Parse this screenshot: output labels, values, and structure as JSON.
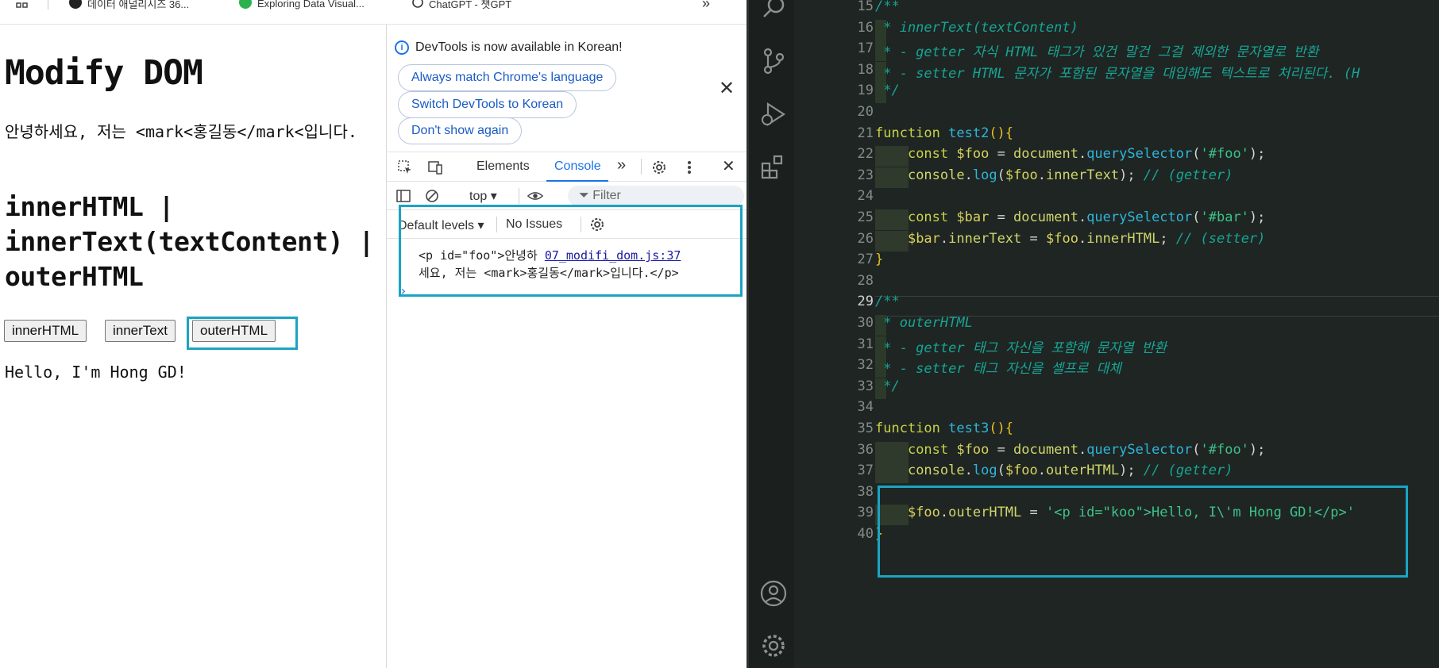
{
  "bookmarks": [
    {
      "icon": "apps-grid-icon",
      "label": ""
    },
    {
      "icon": "github-icon",
      "label": "데이터 애널리시즈 36..."
    },
    {
      "icon": "green-shield-icon",
      "label": "Exploring Data Visual..."
    },
    {
      "icon": "openai-icon",
      "label": "ChatGPT - 챗GPT"
    },
    {
      "icon": "more-bookmarks-icon",
      "label": "»"
    }
  ],
  "page": {
    "title": "Modify DOM",
    "intro": "안녕하세요, 저는 <mark<홍길동</mark<입니다.",
    "heading": "innerHTML | innerText(textContent) | outerHTML",
    "buttons": [
      "innerHTML",
      "innerText",
      "outerHTML"
    ],
    "result": "Hello, I'm Hong GD!"
  },
  "devtools": {
    "notice": "DevTools is now available in Korean!",
    "notice_buttons": [
      "Always match Chrome's language",
      "Switch DevTools to Korean",
      "Don't show again"
    ],
    "tabs": [
      "Elements",
      "Console"
    ],
    "active_tab": "Console",
    "context": "top",
    "filter_placeholder": "Filter",
    "levels": "Default levels",
    "issues": "No Issues",
    "console_log": {
      "text_line1": "<p id=\"foo\">안녕하",
      "source": "07_modifi_dom.js:37",
      "text_line2": "세요, 저는 <mark>홍길동</mark>입니다.</p>"
    },
    "prompt": "›",
    "accent_color": "#1a73e8"
  },
  "editor": {
    "current_line": 29,
    "lines": [
      {
        "n": 15,
        "tokens": [
          [
            "c-com",
            "/**"
          ]
        ]
      },
      {
        "n": 16,
        "tokens": [
          [
            "c-com",
            " * innerText(textContent)"
          ]
        ]
      },
      {
        "n": 17,
        "tokens": [
          [
            "c-com",
            " * - getter 자식 HTML 태그가 있건 말건 그걸 제외한 문자열로 반환"
          ]
        ]
      },
      {
        "n": 18,
        "tokens": [
          [
            "c-com",
            " * - setter HTML 문자가 포함된 문자열을 대입해도 텍스트로 처리된다. (H"
          ]
        ]
      },
      {
        "n": 19,
        "tokens": [
          [
            "c-com",
            " */"
          ]
        ]
      },
      {
        "n": 20,
        "tokens": []
      },
      {
        "n": 21,
        "tokens": [
          [
            "c-kw",
            "function "
          ],
          [
            "c-fn",
            "test2"
          ],
          [
            "c-br",
            "(){"
          ]
        ]
      },
      {
        "n": 22,
        "tokens": [
          [
            "c-plain",
            "    "
          ],
          [
            "c-kw",
            "const "
          ],
          [
            "c-var",
            "$foo"
          ],
          [
            "c-plain",
            " = "
          ],
          [
            "c-prop",
            "document"
          ],
          [
            "c-plain",
            "."
          ],
          [
            "c-fn",
            "querySelector"
          ],
          [
            "c-plain",
            "("
          ],
          [
            "c-str",
            "'#foo'"
          ],
          [
            "c-plain",
            ");"
          ]
        ]
      },
      {
        "n": 23,
        "tokens": [
          [
            "c-plain",
            "    "
          ],
          [
            "c-prop",
            "console"
          ],
          [
            "c-plain",
            "."
          ],
          [
            "c-fn",
            "log"
          ],
          [
            "c-plain",
            "("
          ],
          [
            "c-var",
            "$foo"
          ],
          [
            "c-plain",
            "."
          ],
          [
            "c-prop",
            "innerText"
          ],
          [
            "c-plain",
            "); "
          ],
          [
            "c-com",
            "// (getter)"
          ]
        ]
      },
      {
        "n": 24,
        "tokens": []
      },
      {
        "n": 25,
        "tokens": [
          [
            "c-plain",
            "    "
          ],
          [
            "c-kw",
            "const "
          ],
          [
            "c-var",
            "$bar"
          ],
          [
            "c-plain",
            " = "
          ],
          [
            "c-prop",
            "document"
          ],
          [
            "c-plain",
            "."
          ],
          [
            "c-fn",
            "querySelector"
          ],
          [
            "c-plain",
            "("
          ],
          [
            "c-str",
            "'#bar'"
          ],
          [
            "c-plain",
            ");"
          ]
        ]
      },
      {
        "n": 26,
        "tokens": [
          [
            "c-plain",
            "    "
          ],
          [
            "c-var",
            "$bar"
          ],
          [
            "c-plain",
            "."
          ],
          [
            "c-prop",
            "innerText"
          ],
          [
            "c-plain",
            " = "
          ],
          [
            "c-var",
            "$foo"
          ],
          [
            "c-plain",
            "."
          ],
          [
            "c-prop",
            "innerHTML"
          ],
          [
            "c-plain",
            "; "
          ],
          [
            "c-com",
            "// (setter)"
          ]
        ]
      },
      {
        "n": 27,
        "tokens": [
          [
            "c-br",
            "}"
          ]
        ]
      },
      {
        "n": 28,
        "tokens": []
      },
      {
        "n": 29,
        "tokens": [
          [
            "c-com",
            "/**"
          ]
        ]
      },
      {
        "n": 30,
        "tokens": [
          [
            "c-com",
            " * outerHTML"
          ]
        ]
      },
      {
        "n": 31,
        "tokens": [
          [
            "c-com",
            " * - getter 태그 자신을 포함해 문자열 반환"
          ]
        ]
      },
      {
        "n": 32,
        "tokens": [
          [
            "c-com",
            " * - setter 태그 자신을 셀프로 대체"
          ]
        ]
      },
      {
        "n": 33,
        "tokens": [
          [
            "c-com",
            " */"
          ]
        ]
      },
      {
        "n": 34,
        "tokens": []
      },
      {
        "n": 35,
        "tokens": [
          [
            "c-kw",
            "function "
          ],
          [
            "c-fn",
            "test3"
          ],
          [
            "c-br",
            "(){"
          ]
        ]
      },
      {
        "n": 36,
        "tokens": [
          [
            "c-plain",
            "    "
          ],
          [
            "c-kw",
            "const "
          ],
          [
            "c-var",
            "$foo"
          ],
          [
            "c-plain",
            " = "
          ],
          [
            "c-prop",
            "document"
          ],
          [
            "c-plain",
            "."
          ],
          [
            "c-fn",
            "querySelector"
          ],
          [
            "c-plain",
            "("
          ],
          [
            "c-str",
            "'#foo'"
          ],
          [
            "c-plain",
            ");"
          ]
        ]
      },
      {
        "n": 37,
        "tokens": [
          [
            "c-plain",
            "    "
          ],
          [
            "c-prop",
            "console"
          ],
          [
            "c-plain",
            "."
          ],
          [
            "c-fn",
            "log"
          ],
          [
            "c-plain",
            "("
          ],
          [
            "c-var",
            "$foo"
          ],
          [
            "c-plain",
            "."
          ],
          [
            "c-prop",
            "outerHTML"
          ],
          [
            "c-plain",
            "); "
          ],
          [
            "c-com",
            "// (getter)"
          ]
        ]
      },
      {
        "n": 38,
        "tokens": []
      },
      {
        "n": 39,
        "tokens": [
          [
            "c-plain",
            "    "
          ],
          [
            "c-var",
            "$foo"
          ],
          [
            "c-plain",
            "."
          ],
          [
            "c-prop",
            "outerHTML"
          ],
          [
            "c-plain",
            " = "
          ],
          [
            "c-str",
            "'<p id=\"koo\">Hello, I\\'m Hong GD!</p>'"
          ]
        ]
      },
      {
        "n": 40,
        "tokens": [
          [
            "c-br",
            "}"
          ]
        ]
      }
    ],
    "highlight_color": "#1aa4c4"
  },
  "activity_bar": [
    "search-icon",
    "source-control-icon",
    "run-debug-icon",
    "extensions-icon",
    "account-icon",
    "settings-gear-icon"
  ]
}
